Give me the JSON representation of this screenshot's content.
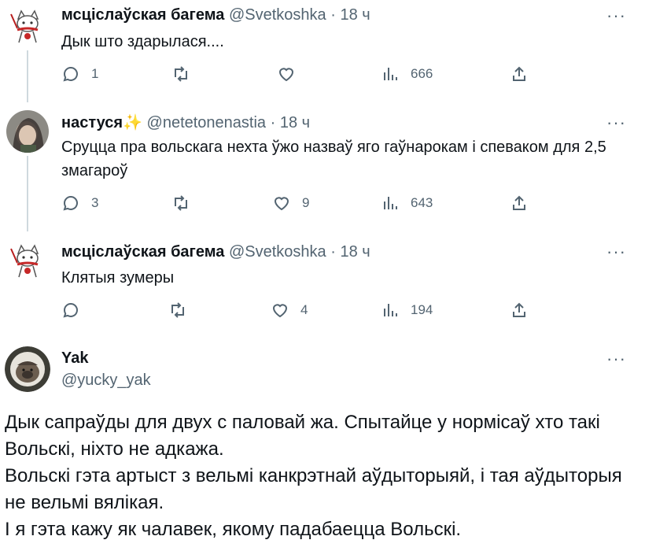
{
  "tweets": [
    {
      "name": "мсціслаўская багема",
      "handle": "@Svetkoshka",
      "time": "18 ч",
      "text": "Дык што здарылася....",
      "replies": "1",
      "retweets": "",
      "likes": "",
      "views": "666"
    },
    {
      "name": "настуся",
      "name_emoji": "✨",
      "handle": "@netetonenastia",
      "time": "18 ч",
      "text": "Сруцца пра вольскага нехта ўжо назваў яго гаўнарокам і спеваком для 2,5 змагароў",
      "replies": "3",
      "retweets": "",
      "likes": "9",
      "views": "643"
    },
    {
      "name": "мсціслаўская багема",
      "handle": "@Svetkoshka",
      "time": "18 ч",
      "text": "Клятыя зумеры",
      "replies": "",
      "retweets": "",
      "likes": "4",
      "views": "194"
    }
  ],
  "main_tweet": {
    "name": "Yak",
    "handle": "@yucky_yak",
    "paragraphs": [
      "Дык сапраўды для двух с паловай жа. Спытайце у нормісаў хто такі Вольскі, ніхто не адкажа.",
      "Вольскі гэта артыст з вельмі канкрэтнай аўдыторыяй, і тая аўдыторыя не вельмі вялікая.",
      "І я гэта кажу як чалавек, якому падабаецца Вольскі."
    ]
  },
  "ui": {
    "dot": "·",
    "more": "···"
  },
  "colors": {
    "text": "#0f1419",
    "secondary": "#536471",
    "thread_line": "#cfd9de"
  }
}
